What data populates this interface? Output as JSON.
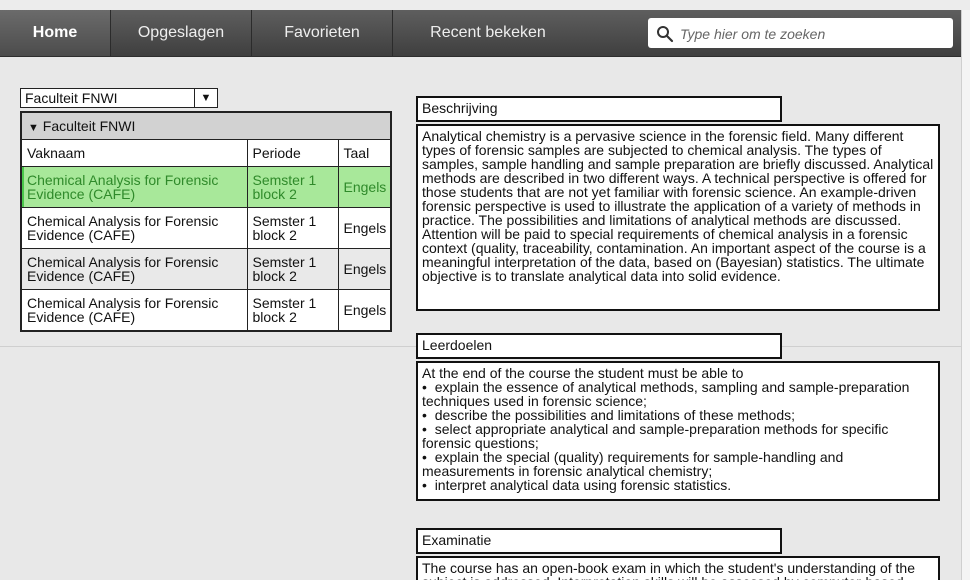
{
  "nav": {
    "tabs": [
      {
        "label": "Home"
      },
      {
        "label": "Opgeslagen"
      },
      {
        "label": "Favorieten"
      },
      {
        "label": "Recent bekeken"
      }
    ],
    "search_placeholder": "Type hier om te zoeken"
  },
  "faculty_select": {
    "value": "Faculteit FNWI"
  },
  "group": {
    "label": "Faculteit FNWI",
    "toggle_icon": "triangle-down"
  },
  "table": {
    "columns": [
      "Vaknaam",
      "Periode",
      "Taal"
    ],
    "rows": [
      {
        "name": "Chemical Analysis for Forensic Evidence (CAFE)",
        "period": "Semster 1 block 2",
        "lang": "Engels"
      },
      {
        "name": "Chemical Analysis for Forensic Evidence (CAFE)",
        "period": "Semster 1 block 2",
        "lang": "Engels"
      },
      {
        "name": "Chemical Analysis for Forensic Evidence (CAFE)",
        "period": "Semster 1 block 2",
        "lang": "Engels"
      },
      {
        "name": "Chemical Analysis for Forensic Evidence (CAFE)",
        "period": "Semster 1 block 2",
        "lang": "Engels"
      }
    ]
  },
  "sections": {
    "beschrijving": {
      "title": "Beschrijving",
      "text": "Analytical chemistry is a pervasive science in the forensic field. Many different types of forensic samples are subjected to chemical analysis. The types of samples, sample handling and sample preparation are briefly discussed. Analytical methods are described in two different ways. A technical perspective is offered for those students that are not yet familiar with forensic science. An example-driven forensic perspective is used to illustrate the application of a variety of methods in practice. The possibilities and limitations of analytical methods are discussed. Attention will be paid to special requirements of chemical analysis in a forensic context (quality, traceability, contamination. An important aspect of the course is a meaningful interpretation of the data, based on (Bayesian) statistics. The ultimate objective is to translate analytical data into solid evidence."
    },
    "leerdoelen": {
      "title": "Leerdoelen",
      "intro": "At the end of the course the student must be able to",
      "items": [
        "explain the essence of analytical methods, sampling and sample-preparation techniques used in forensic science;",
        "describe the possibilities and limitations of these methods;",
        "select appropriate analytical and sample-preparation methods for specific forensic questions;",
        "explain the special (quality) requirements for sample-handling and measurements in forensic analytical chemistry;",
        "interpret analytical data using forensic statistics."
      ]
    },
    "examinatie": {
      "title": "Examinatie",
      "text": "The course has an open-book exam in which the student's understanding of the subject is addressed. Interpretation skills will be assessed by computer-based"
    }
  }
}
